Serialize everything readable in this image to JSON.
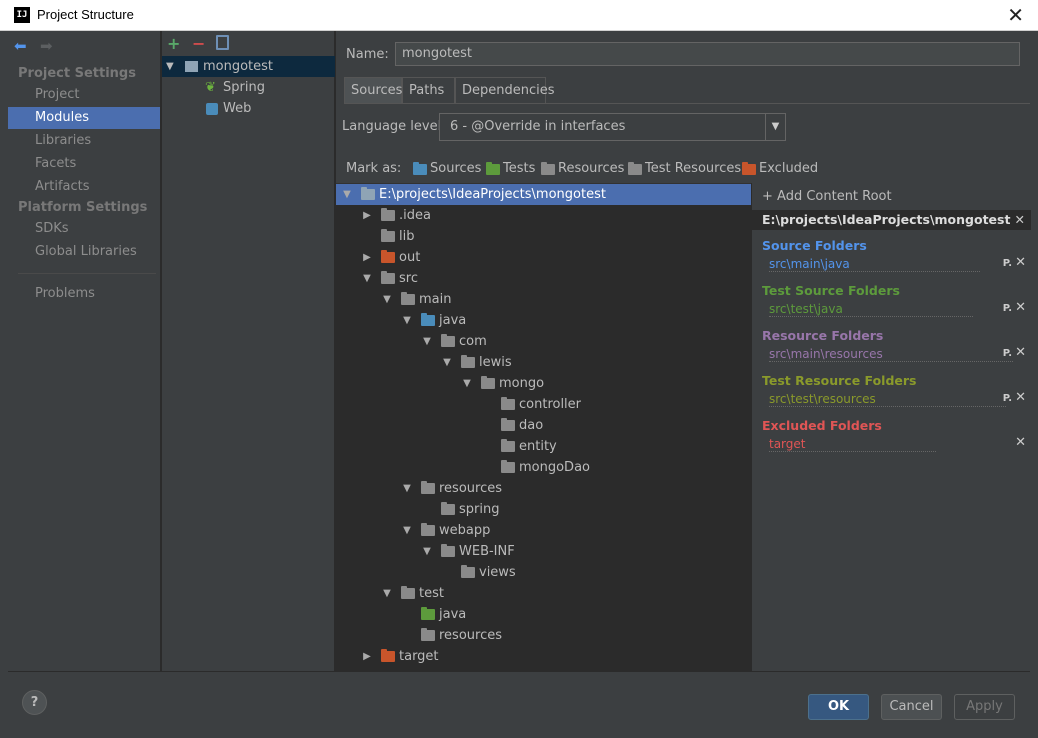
{
  "window": {
    "title": "Project Structure",
    "close_glyph": "✕"
  },
  "nav": {
    "sections": [
      {
        "title": "Project Settings",
        "items": [
          "Project",
          "Modules",
          "Libraries",
          "Facets",
          "Artifacts"
        ]
      },
      {
        "title": "Platform Settings",
        "items": [
          "SDKs",
          "Global Libraries"
        ]
      }
    ],
    "extra_items": [
      "Problems"
    ],
    "selected": "Modules"
  },
  "modules": {
    "toolbar": {
      "add": "+",
      "remove": "−",
      "copy": "copy-icon"
    },
    "tree": [
      {
        "label": "mongotest",
        "selected": true
      },
      {
        "label": "Spring"
      },
      {
        "label": "Web"
      }
    ]
  },
  "module_settings": {
    "name_label": "Name:",
    "name_value": "mongotest",
    "tabs": [
      "Sources",
      "Paths",
      "Dependencies"
    ],
    "active_tab": "Sources",
    "language_level_label": "Language level:",
    "language_level_value": "6 - @Override in interfaces",
    "mark_as_label": "Mark as:",
    "mark_as": [
      {
        "label": "Sources",
        "color": "#4a8cba"
      },
      {
        "label": "Tests",
        "color": "#5d9b3c"
      },
      {
        "label": "Resources",
        "color": "#8a8a8a"
      },
      {
        "label": "Test Resources",
        "color": "#8a8a8a"
      },
      {
        "label": "Excluded",
        "color": "#c8552b"
      }
    ]
  },
  "file_tree": [
    {
      "label": "E:\\projects\\IdeaProjects\\mongotest",
      "toggle": "open",
      "color": "#8fa4b5",
      "selected": true
    },
    {
      "label": ".idea",
      "toggle": "closed",
      "color": "#8a8a8a"
    },
    {
      "label": "lib",
      "toggle": "",
      "color": "#8a8a8a"
    },
    {
      "label": "out",
      "toggle": "closed",
      "color": "#c8552b"
    },
    {
      "label": "src",
      "toggle": "open",
      "color": "#8a8a8a"
    },
    {
      "label": "main",
      "toggle": "open",
      "color": "#8a8a8a"
    },
    {
      "label": "java",
      "toggle": "open",
      "color": "#4a8cba"
    },
    {
      "label": "com",
      "toggle": "open",
      "color": "#8a8a8a"
    },
    {
      "label": "lewis",
      "toggle": "open",
      "color": "#8a8a8a"
    },
    {
      "label": "mongo",
      "toggle": "open",
      "color": "#8a8a8a"
    },
    {
      "label": "controller",
      "toggle": "",
      "color": "#8a8a8a"
    },
    {
      "label": "dao",
      "toggle": "",
      "color": "#8a8a8a"
    },
    {
      "label": "entity",
      "toggle": "",
      "color": "#8a8a8a"
    },
    {
      "label": "mongoDao",
      "toggle": "",
      "color": "#8a8a8a"
    },
    {
      "label": "resources",
      "toggle": "open",
      "color": "#8a8a8a"
    },
    {
      "label": "spring",
      "toggle": "",
      "color": "#8a8a8a"
    },
    {
      "label": "webapp",
      "toggle": "open",
      "color": "#8a8a8a"
    },
    {
      "label": "WEB-INF",
      "toggle": "open",
      "color": "#8a8a8a"
    },
    {
      "label": "views",
      "toggle": "",
      "color": "#8a8a8a"
    },
    {
      "label": "test",
      "toggle": "open",
      "color": "#8a8a8a"
    },
    {
      "label": "java",
      "toggle": "",
      "color": "#5d9b3c"
    },
    {
      "label": "resources",
      "toggle": "",
      "color": "#8a8a8a"
    },
    {
      "label": "target",
      "toggle": "closed",
      "color": "#c8552b"
    }
  ],
  "content_root": {
    "add_label": "+ Add Content Root",
    "root_path": "E:\\projects\\IdeaProjects\\mongotest",
    "groups": [
      {
        "title": "Source Folders",
        "path": "src\\main\\java",
        "color": "#5394ec",
        "path_color": "#5394ec",
        "has_p": true
      },
      {
        "title": "Test Source Folders",
        "path": "src\\test\\java",
        "color": "#5d9b3c",
        "path_color": "#5d9b3c",
        "has_p": true
      },
      {
        "title": "Resource Folders",
        "path": "src\\main\\resources",
        "color": "#9876aa",
        "path_color": "#9876aa",
        "has_p": true
      },
      {
        "title": "Test Resource Folders",
        "path": "src\\test\\resources",
        "color": "#8a9a2b",
        "path_color": "#8a9a2b",
        "has_p": true
      },
      {
        "title": "Excluded Folders",
        "path": "target",
        "color": "#e05555",
        "path_color": "#e05555",
        "has_p": false
      }
    ],
    "p_glyph": "P.",
    "x_glyph": "✕"
  },
  "buttons": {
    "help": "?",
    "ok": "OK",
    "cancel": "Cancel",
    "apply": "Apply"
  }
}
